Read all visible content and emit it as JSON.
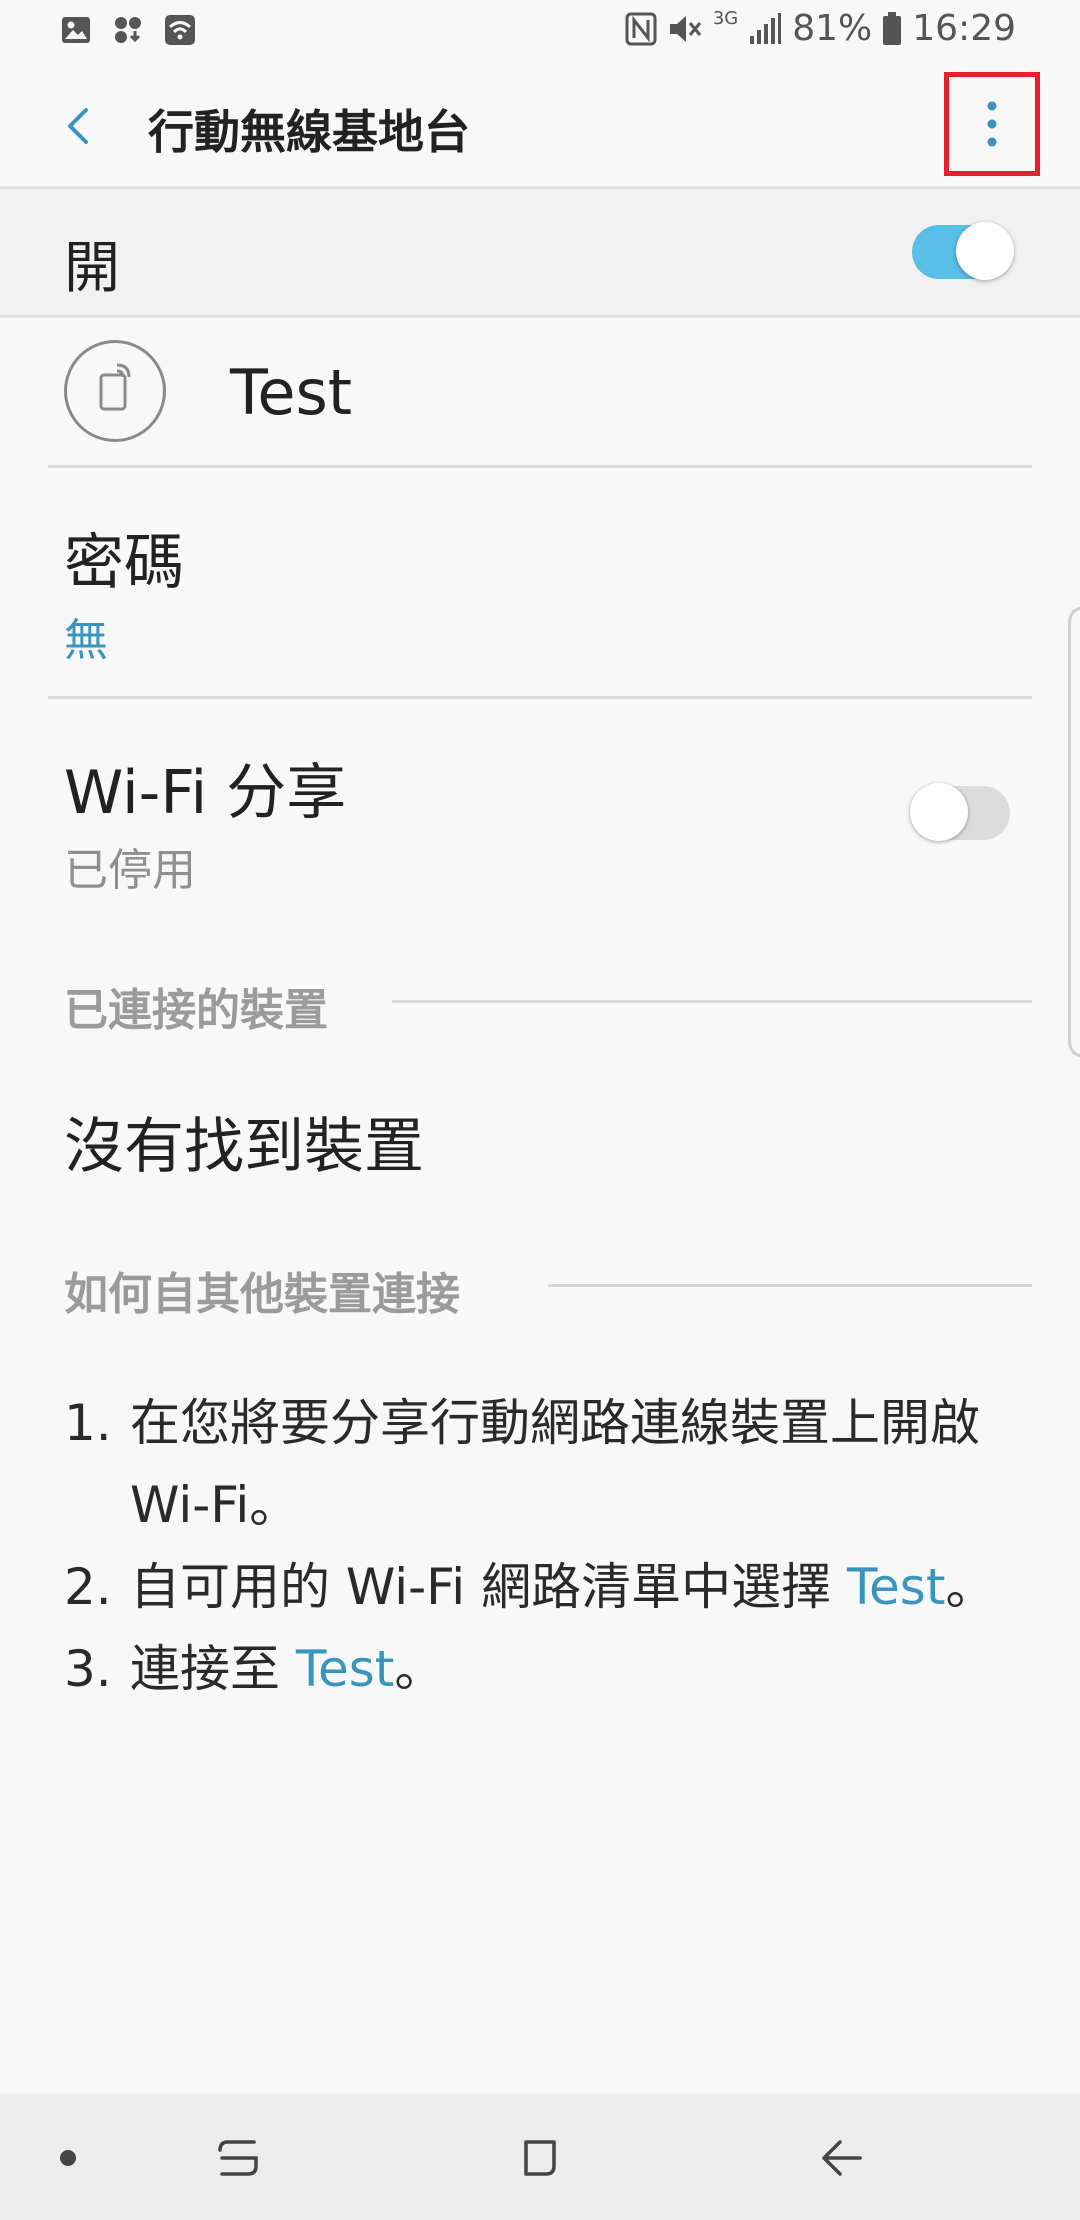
{
  "status_bar": {
    "battery": "81%",
    "time": "16:29",
    "network_type": "3G",
    "icons": [
      "image-icon",
      "download-icon",
      "wifi-icon",
      "nfc-icon",
      "mute-icon",
      "signal-icon",
      "battery-icon"
    ]
  },
  "app_bar": {
    "title": "行動無線基地台",
    "back_icon": "chevron-left-icon",
    "more_icon": "more-vertical-icon"
  },
  "master": {
    "label": "開",
    "enabled": true
  },
  "network": {
    "name": "Test",
    "icon": "mobile-hotspot-icon"
  },
  "password": {
    "title": "密碼",
    "value": "無"
  },
  "wifi_sharing": {
    "title": "Wi-Fi 分享",
    "status": "已停用",
    "enabled": false
  },
  "connected_devices": {
    "header": "已連接的裝置",
    "empty_text": "沒有找到裝置"
  },
  "how_to": {
    "header": "如何自其他裝置連接",
    "steps": [
      {
        "num": "1.",
        "text": "在您將要分享行動網路連線裝置上開啟 Wi-Fi。"
      },
      {
        "num": "2.",
        "text_before": "自可用的 Wi-Fi 網路清單中選擇",
        "link": "Test",
        "text_after": "。"
      },
      {
        "num": "3.",
        "text_before": "連接至 ",
        "link": "Test",
        "text_after": "。"
      }
    ]
  },
  "colors": {
    "accent": "#3a95be",
    "toggle_on": "#58bfe6",
    "highlight_box": "#e3202b"
  },
  "nav_bar": {
    "icons": [
      "dot-icon",
      "recent-apps-icon",
      "home-icon",
      "back-arrow-icon"
    ]
  }
}
